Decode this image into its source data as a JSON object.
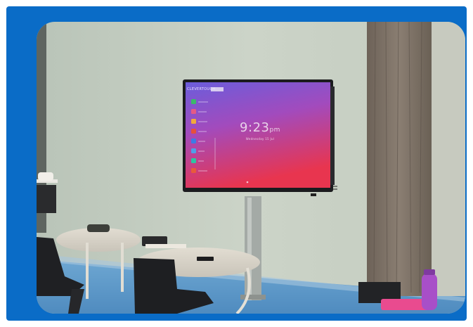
{
  "screen": {
    "brand": "CLEVERTOUCH",
    "time": "9:23",
    "ampm": "pm",
    "date": "Wednesday 15 Jul"
  },
  "colors": {
    "frame_blue": "#0a6cc7",
    "wall": "#c9d2c6",
    "floor": "#5f98c4",
    "screen_top": "#7b5bd6",
    "screen_bottom": "#e2345a"
  }
}
